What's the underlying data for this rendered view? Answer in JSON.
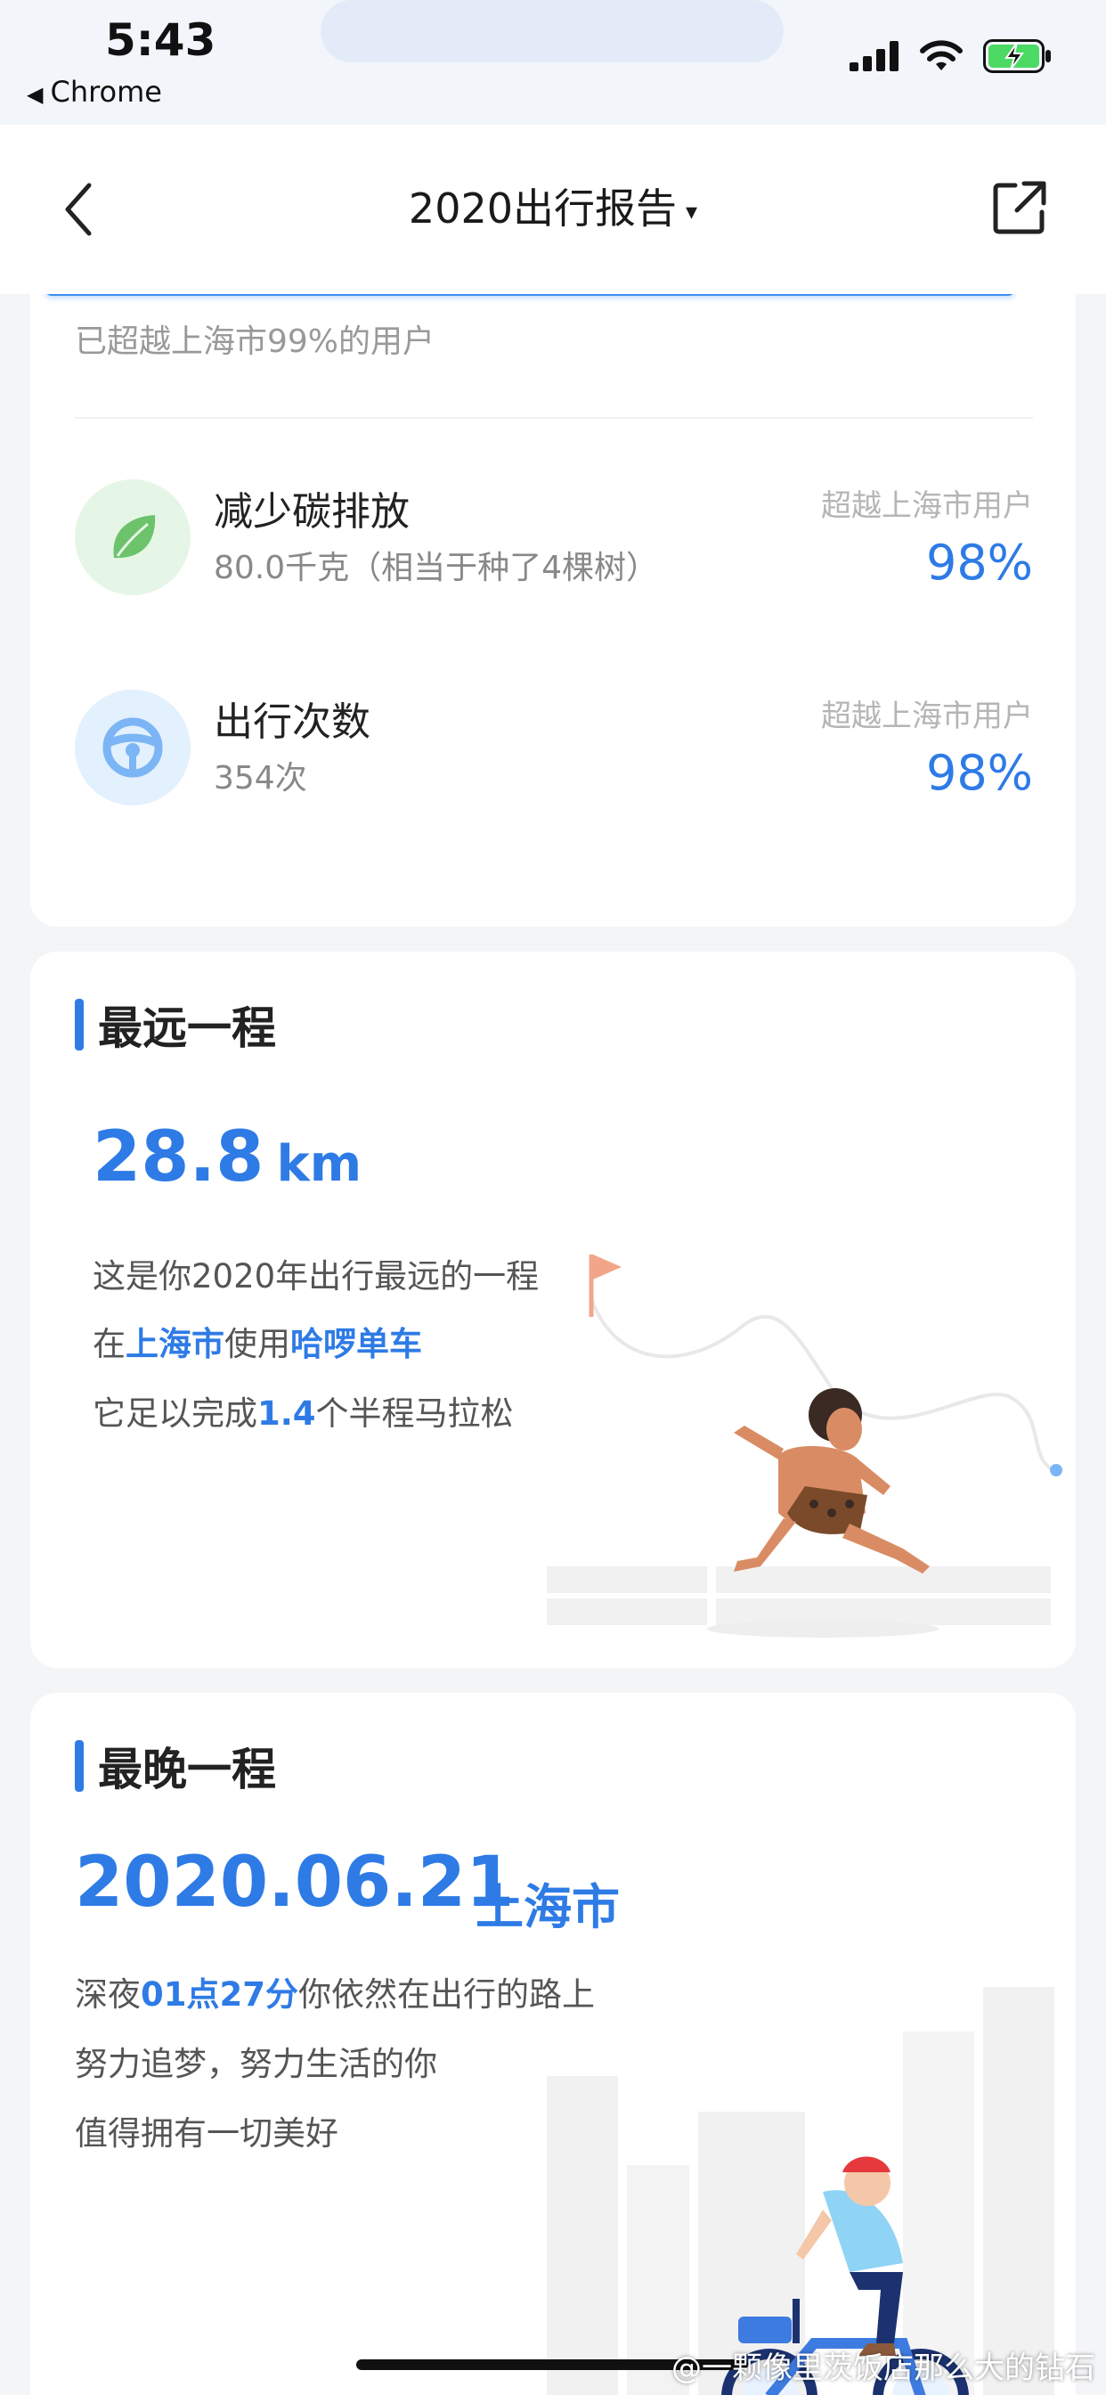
{
  "status_bar": {
    "time": "5:43",
    "back_app": "Chrome"
  },
  "nav": {
    "title": "2020出行报告",
    "caret": "▾"
  },
  "summary": {
    "exceed_text": "已超越上海市99%的用户",
    "stats": [
      {
        "icon": "leaf-icon",
        "title": "减少碳排放",
        "subtitle": "80.0千克（相当于种了4棵树）",
        "right_label": "超越上海市用户",
        "right_value": "98%"
      },
      {
        "icon": "steering-wheel-icon",
        "title": "出行次数",
        "subtitle": "354次",
        "right_label": "超越上海市用户",
        "right_value": "98%"
      }
    ]
  },
  "farthest": {
    "title": "最远一程",
    "distance": "28.8",
    "unit": "km",
    "line1": "这是你2020年出行最远的一程",
    "line2_pre": "在",
    "line2_city": "上海市",
    "line2_mid": "使用",
    "line2_brand": "哈啰单车",
    "line3_pre": "它足以完成",
    "line3_num": "1.4",
    "line3_post": "个半程马拉松"
  },
  "latest": {
    "title": "最晚一程",
    "date": "2020.06.21",
    "city": "上海市",
    "line1_pre": "深夜",
    "line1_time": "01点27分",
    "line1_post": "你依然在出行的路上",
    "line2": "努力追梦，努力生活的你",
    "line3": "值得拥有一切美好"
  },
  "watermark": "@一颗像里茨饭店那么大的钻石",
  "colors": {
    "accent": "#2e7be6",
    "leaf_bg": "#e6f6e6",
    "leaf": "#6cc36c",
    "wheel_bg": "#e3f0fd",
    "wheel": "#7cb5f5"
  }
}
